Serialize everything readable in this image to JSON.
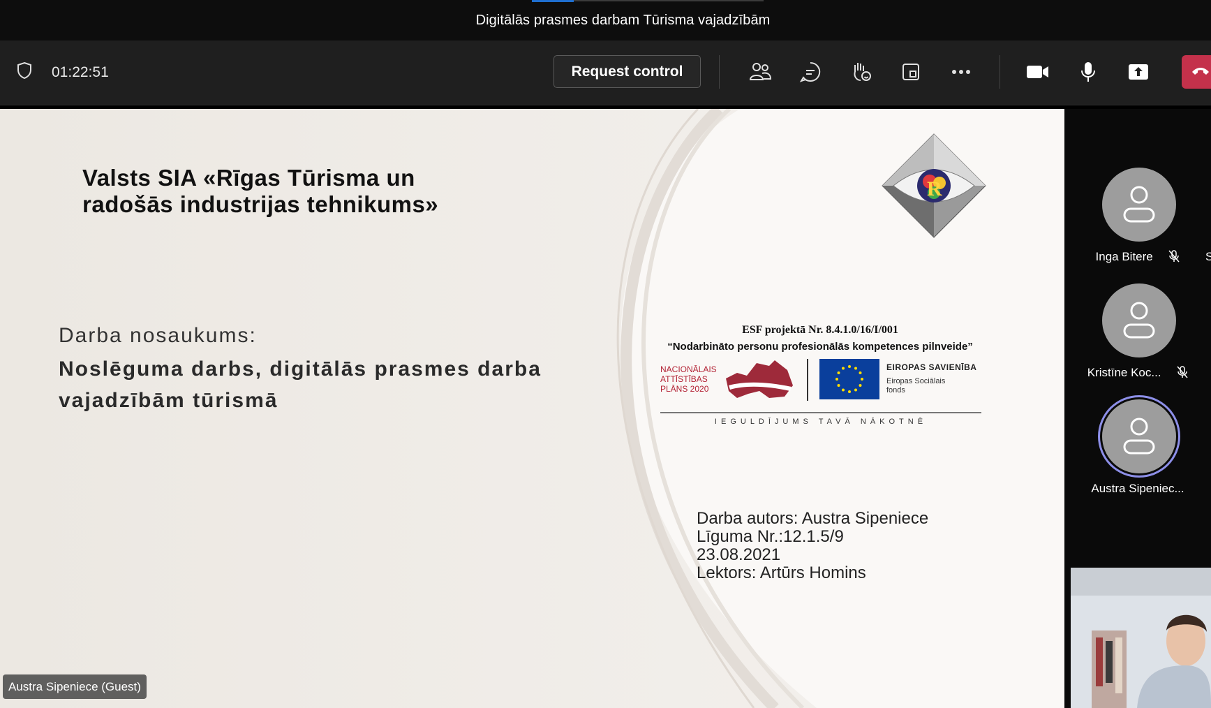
{
  "meeting": {
    "title": "Digitālās prasmes darbam Tūrisma vajadzībām",
    "timer": "01:22:51"
  },
  "toolbar": {
    "request_control_label": "Request control",
    "icons": [
      "shield-icon",
      "participants-icon",
      "chat-icon",
      "raise-hand-icon",
      "view-icon",
      "more-icon",
      "camera-icon",
      "microphone-icon",
      "share-icon",
      "hang-up-icon"
    ]
  },
  "slide": {
    "school_name": "Valsts SIA «Rīgas Tūrisma un\nradošās industrijas tehnikums»",
    "work_label": "Darba nosaukums:",
    "work_title": "Noslēguma darbs, digitālās prasmes darba vajadzībām tūrismā",
    "esf": {
      "project": "ESF projektā Nr. 8.4.1.0/16/I/001",
      "project_name": "“Nodarbināto personu profesionālās kompetences pilnveide”",
      "nap_line1": "NACIONĀLAIS",
      "nap_line2": "ATTĪSTĪBAS",
      "nap_line3": "PLĀNS 2020",
      "eu_label": "EIROPAS SAVIENĪBA",
      "eu_fund_line1": "Eiropas Sociālais",
      "eu_fund_line2": "fonds",
      "motto": "IEGULDĪJUMS TAVĀ NĀKOTNĒ"
    },
    "author_line": "Darba autors: Austra Sipeniece",
    "contract_line": "Līguma Nr.:12.1.5/9",
    "date_line": "23.08.2021",
    "lecturer_line": "Lektors: Artūrs Homins",
    "presenter_tag": "Austra Sipeniece (Guest)"
  },
  "participants": [
    {
      "name": "Inga Bitere",
      "muted": true
    },
    {
      "name": "Kristīne Koc...",
      "muted": true
    },
    {
      "name": "Austra Sipeniec...",
      "muted": false,
      "speaking": true
    }
  ],
  "participants_overflow_letter": "S",
  "colors": {
    "toolbar_bg": "#1f1f1f",
    "hangup": "#c4314b",
    "active_ring": "#8d8fe8"
  }
}
